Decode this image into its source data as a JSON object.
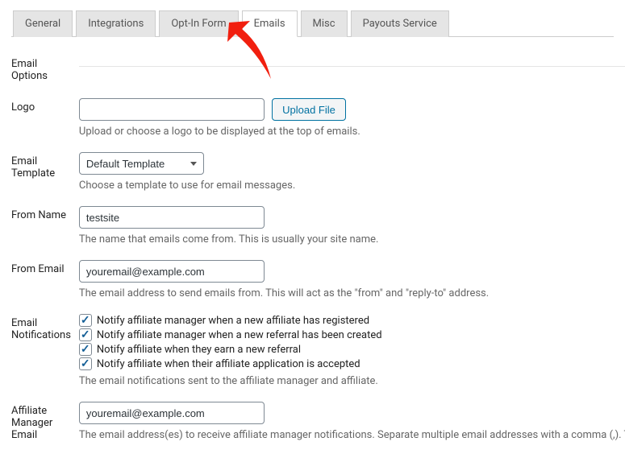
{
  "tabs": {
    "general": "General",
    "integrations": "Integrations",
    "optin": "Opt-In Form",
    "emails": "Emails",
    "misc": "Misc",
    "payouts": "Payouts Service"
  },
  "heading": "Email Options",
  "logo": {
    "label": "Logo",
    "value": "",
    "upload_btn": "Upload File",
    "desc": "Upload or choose a logo to be displayed at the top of emails."
  },
  "template": {
    "label": "Email Template",
    "selected": "Default Template",
    "desc": "Choose a template to use for email messages."
  },
  "from_name": {
    "label": "From Name",
    "value": "testsite",
    "desc": "The name that emails come from. This is usually your site name."
  },
  "from_email": {
    "label": "From Email",
    "value": "youremail@example.com",
    "desc": "The email address to send emails from. This will act as the \"from\" and \"reply-to\" address."
  },
  "notifications": {
    "label": "Email Notifications",
    "items": [
      "Notify affiliate manager when a new affiliate has registered",
      "Notify affiliate manager when a new referral has been created",
      "Notify affiliate when they earn a new referral",
      "Notify affiliate when their affiliate application is accepted"
    ],
    "desc": "The email notifications sent to the affiliate manager and affiliate."
  },
  "manager_email": {
    "label": "Affiliate Manager Email",
    "value": "youremail@example.com",
    "desc": "The email address(es) to receive affiliate manager notifications. Separate multiple email addresses with a comma (,). The adm"
  }
}
